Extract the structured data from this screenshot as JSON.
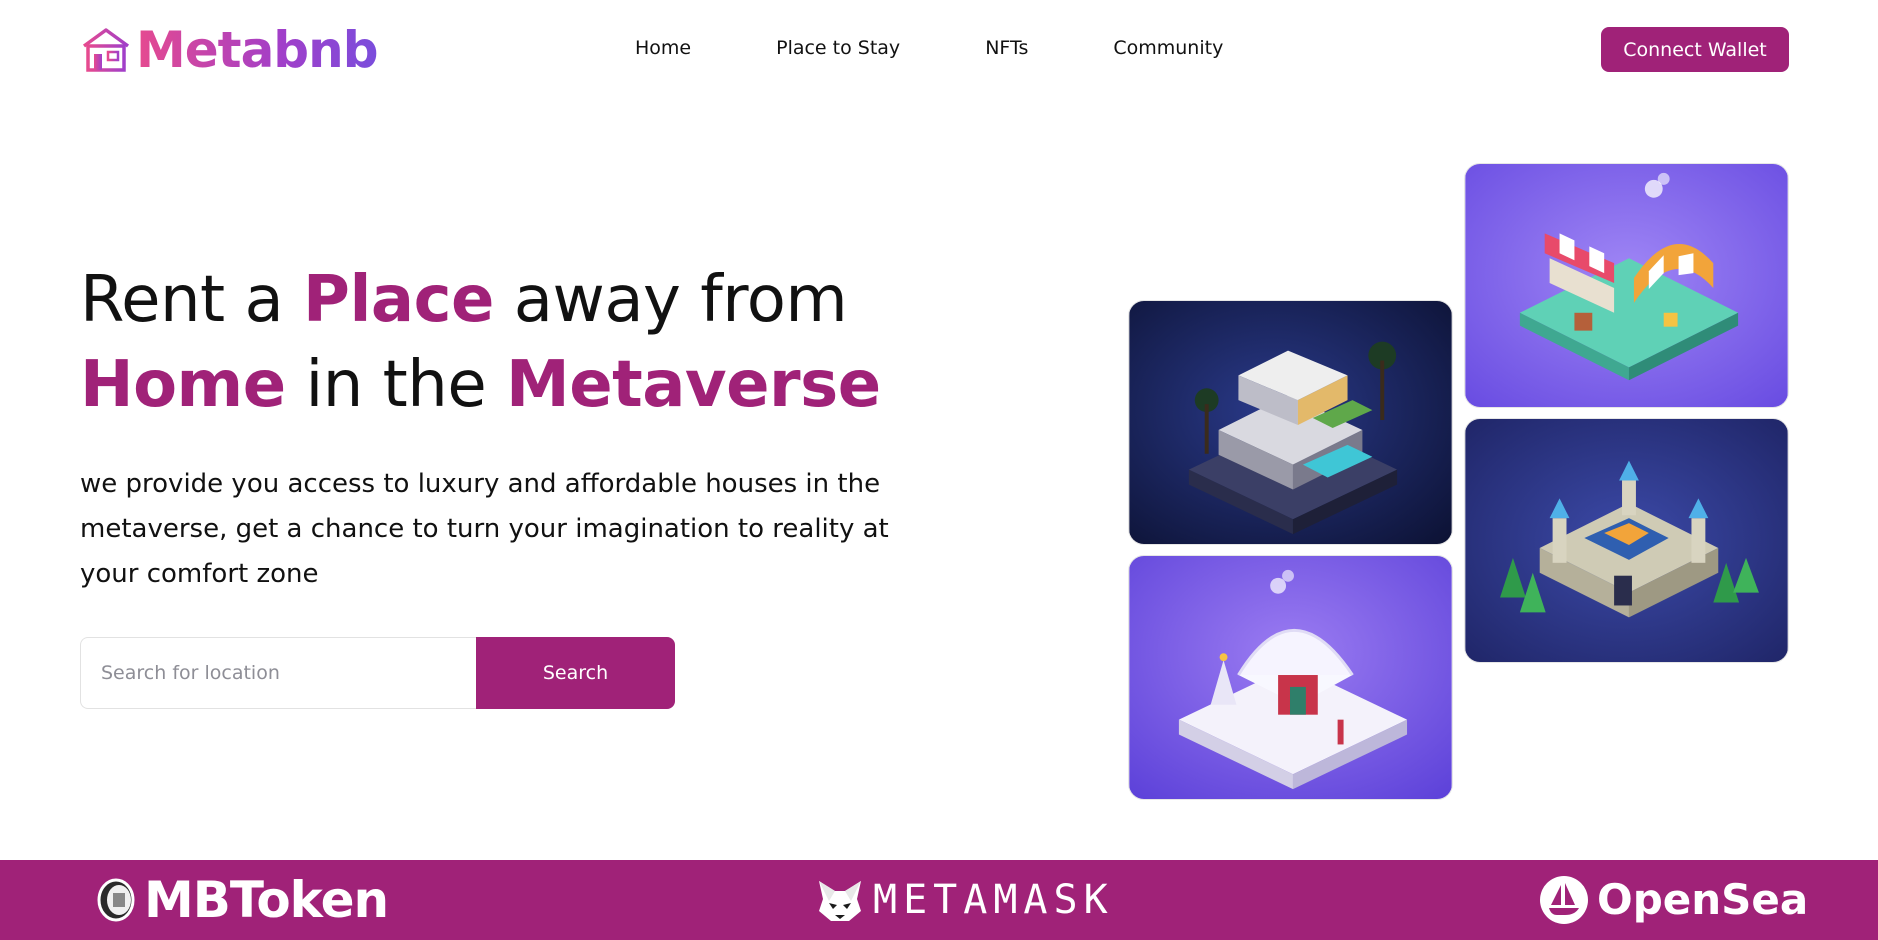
{
  "brand": {
    "name": "Metabnb",
    "gradient": [
      "#e64a8f",
      "#7a4ddc"
    ],
    "icon": "house-icon"
  },
  "nav": {
    "items": [
      {
        "label": "Home"
      },
      {
        "label": "Place to Stay"
      },
      {
        "label": "NFTs"
      },
      {
        "label": "Community"
      }
    ],
    "connect_label": "Connect Wallet"
  },
  "colors": {
    "accent": "#a02278",
    "text": "#111111",
    "background": "#ffffff"
  },
  "hero": {
    "title_parts": [
      "Rent a ",
      "Place",
      " away from ",
      "Home",
      " in the ",
      "Metaverse"
    ],
    "description": "we provide you access to luxury and affordable houses in the metaverse, get a chance to turn your imagination to reality at your comfort zone"
  },
  "search": {
    "placeholder": "Search for location",
    "value": "",
    "button_label": "Search"
  },
  "gallery": [
    {
      "icon": "modern-villa-icon"
    },
    {
      "icon": "snow-cottage-icon"
    },
    {
      "icon": "market-stall-icon"
    },
    {
      "icon": "castle-icon"
    }
  ],
  "partners": [
    {
      "name": "MBToken",
      "icon": "mbtoken-coin-icon"
    },
    {
      "name": "METAMASK",
      "icon": "fox-icon"
    },
    {
      "name": "OpenSea",
      "icon": "opensea-boat-icon"
    }
  ]
}
